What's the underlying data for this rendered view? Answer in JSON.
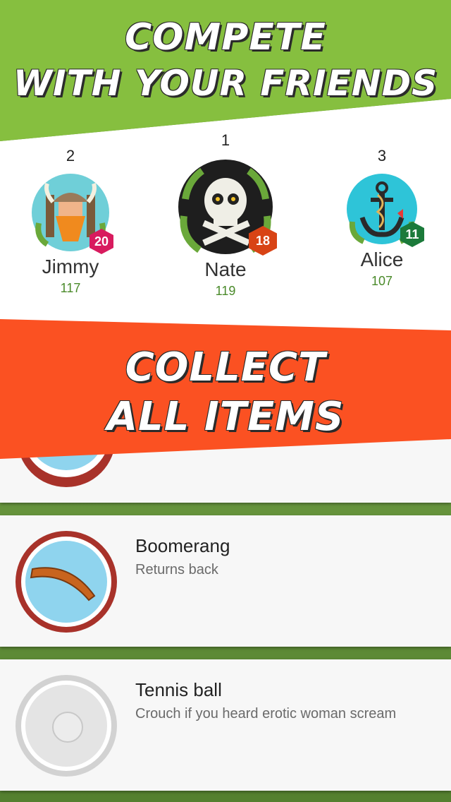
{
  "banners": {
    "compete_line1": "Compete",
    "compete_line2": "with your friends",
    "collect_line1": "Collect",
    "collect_line2": "all items"
  },
  "leaderboard": {
    "players": [
      {
        "rank": "2",
        "name": "Jimmy",
        "score": "117",
        "level": "20",
        "avatar_icon": "viking-icon",
        "badge_color": "#d81b5e"
      },
      {
        "rank": "1",
        "name": "Nate",
        "score": "119",
        "level": "18",
        "avatar_icon": "skull-icon",
        "badge_color": "#d84315"
      },
      {
        "rank": "3",
        "name": "Alice",
        "score": "107",
        "level": "11",
        "avatar_icon": "anchor-icon",
        "badge_color": "#1b7a3a"
      }
    ]
  },
  "items": [
    {
      "title": "",
      "description": "",
      "icon": "item-icon"
    },
    {
      "title": "Boomerang",
      "description": "Returns back",
      "icon": "boomerang-icon"
    },
    {
      "title": "Tennis ball",
      "description": "Crouch if you heard erotic woman scream",
      "icon": "tennis-ball-icon"
    }
  ],
  "colors": {
    "green_band": "#86bf3f",
    "red_band": "#fb5122",
    "score_green": "#4a8a2a"
  }
}
